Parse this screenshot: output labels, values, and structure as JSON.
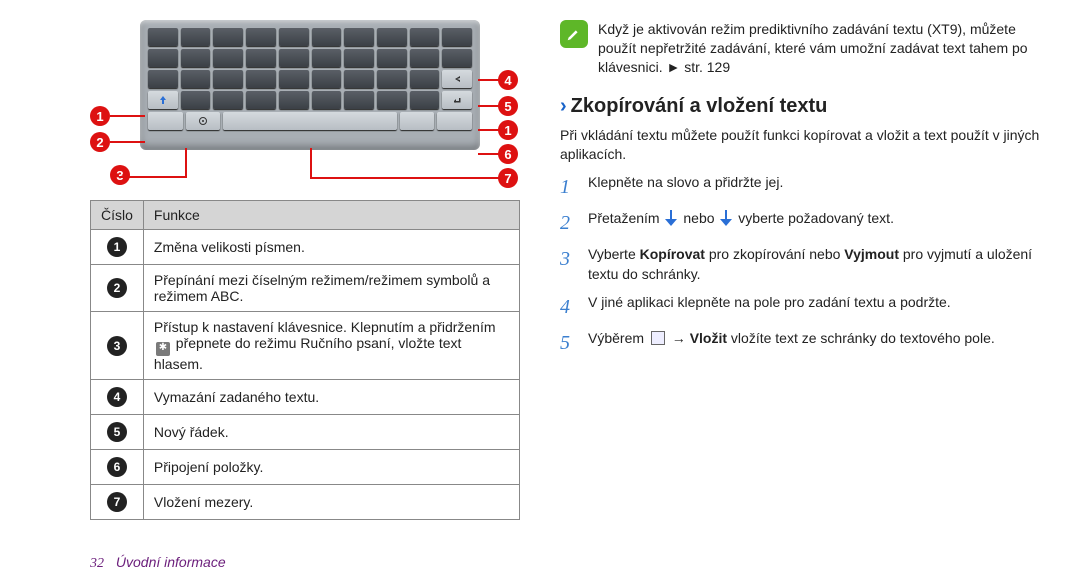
{
  "tip_text": "Když je aktivován režim prediktivního zadávání textu (XT9), můžete použít nepřetržité zadávání, které vám umožní zadávat text tahem po klávesnici. ► str. 129",
  "heading": "Zkopírování a vložení textu",
  "intro": "Při vkládání textu můžete použít funkci kopírovat a vložit a text použít v jiných aplikacích.",
  "steps": [
    {
      "n": "1",
      "text": "Klepněte na slovo a přidržte jej."
    },
    {
      "n": "2",
      "pre": "Přetažením ",
      "mid": " nebo ",
      "post": " vyberte požadovaný text."
    },
    {
      "n": "3",
      "pre": "Vyberte ",
      "b1": "Kopírovat",
      "mid1": " pro zkopírování nebo ",
      "b2": "Vyjmout",
      "post": " pro vyjmutí a uložení textu do schránky."
    },
    {
      "n": "4",
      "text": "V jiné aplikaci klepněte na pole pro zadání textu a podržte."
    },
    {
      "n": "5",
      "pre": "Výběrem ",
      "mid": " → ",
      "b1": "Vložit",
      "post": " vložíte text ze schránky do textového pole."
    }
  ],
  "table": {
    "header_num": "Číslo",
    "header_fn": "Funkce",
    "rows": [
      {
        "n": "1",
        "text": "Změna velikosti písmen."
      },
      {
        "n": "2",
        "text": "Přepínání mezi číselným režimem/režimem symbolů a režimem ABC."
      },
      {
        "n": "3",
        "pre": "Přístup k nastavení klávesnice. Klepnutím a přidržením ",
        "post": " přepnete do režimu Ručního psaní, vložte text hlasem."
      },
      {
        "n": "4",
        "text": "Vymazání zadaného textu."
      },
      {
        "n": "5",
        "text": "Nový řádek."
      },
      {
        "n": "6",
        "text": "Připojení položky."
      },
      {
        "n": "7",
        "text": "Vložení mezery."
      }
    ]
  },
  "page_number": "32",
  "breadcrumb": "Úvodní informace"
}
